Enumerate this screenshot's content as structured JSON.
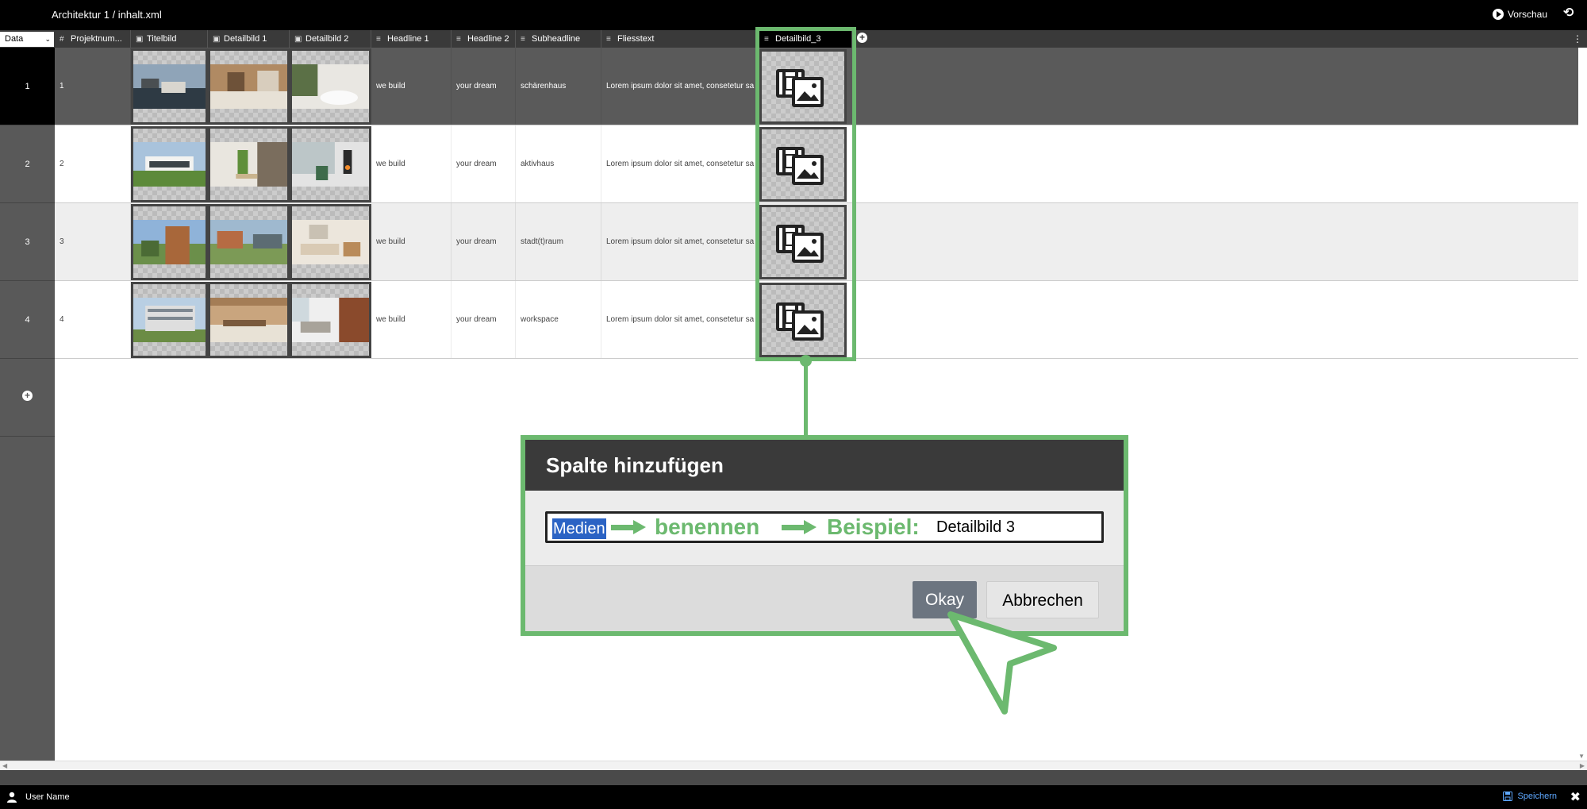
{
  "app": {
    "title": "Architektur 1 / inhalt.xml",
    "preview_label": "Vorschau"
  },
  "header": {
    "data_select": "Data",
    "columns": [
      {
        "label": "Projektnum...",
        "icon": "hash-icon",
        "glyph": "#"
      },
      {
        "label": "Titelbild",
        "icon": "image-icon",
        "glyph": "▣"
      },
      {
        "label": "Detailbild 1",
        "icon": "image-icon",
        "glyph": "▣"
      },
      {
        "label": "Detailbild 2",
        "icon": "image-icon",
        "glyph": "▣"
      },
      {
        "label": "Headline 1",
        "icon": "text-icon",
        "glyph": "≡"
      },
      {
        "label": "Headline 2",
        "icon": "text-icon",
        "glyph": "≡"
      },
      {
        "label": "Subheadline",
        "icon": "text-icon",
        "glyph": "≡"
      },
      {
        "label": "Fliesstext",
        "icon": "text-icon",
        "glyph": "≡"
      },
      {
        "label": "Detailbild_3",
        "icon": "text-icon",
        "glyph": "≡"
      }
    ]
  },
  "rows": [
    {
      "num": "1",
      "projektnummer": "1",
      "headline1": "we build",
      "headline2": "your dream",
      "subheadline": "schärenhaus",
      "fliesstext": "Lorem ipsum dolor sit amet, consetetur sa"
    },
    {
      "num": "2",
      "projektnummer": "2",
      "headline1": "we build",
      "headline2": "your dream",
      "subheadline": "aktivhaus",
      "fliesstext": "Lorem ipsum dolor sit amet, consetetur sa"
    },
    {
      "num": "3",
      "projektnummer": "3",
      "headline1": "we build",
      "headline2": "your dream",
      "subheadline": "stadt(t)raum",
      "fliesstext": "Lorem ipsum dolor sit amet, consetetur sa"
    },
    {
      "num": "4",
      "projektnummer": "4",
      "headline1": "we build",
      "headline2": "your dream",
      "subheadline": "workspace",
      "fliesstext": "Lorem ipsum dolor sit amet, consetetur sa"
    }
  ],
  "dialog": {
    "title": "Spalte hinzufügen",
    "input_selected": "Medien",
    "annotation_1": "benennen",
    "annotation_2": "Beispiel:",
    "example_value": "Detailbild 3",
    "okay_label": "Okay",
    "cancel_label": "Abbrechen"
  },
  "footer": {
    "user_name": "User Name",
    "save_label": "Speichern"
  },
  "colors": {
    "highlight_green": "#6cb96f",
    "selection_blue": "#2b63c4",
    "save_blue": "#5ea8ff"
  }
}
